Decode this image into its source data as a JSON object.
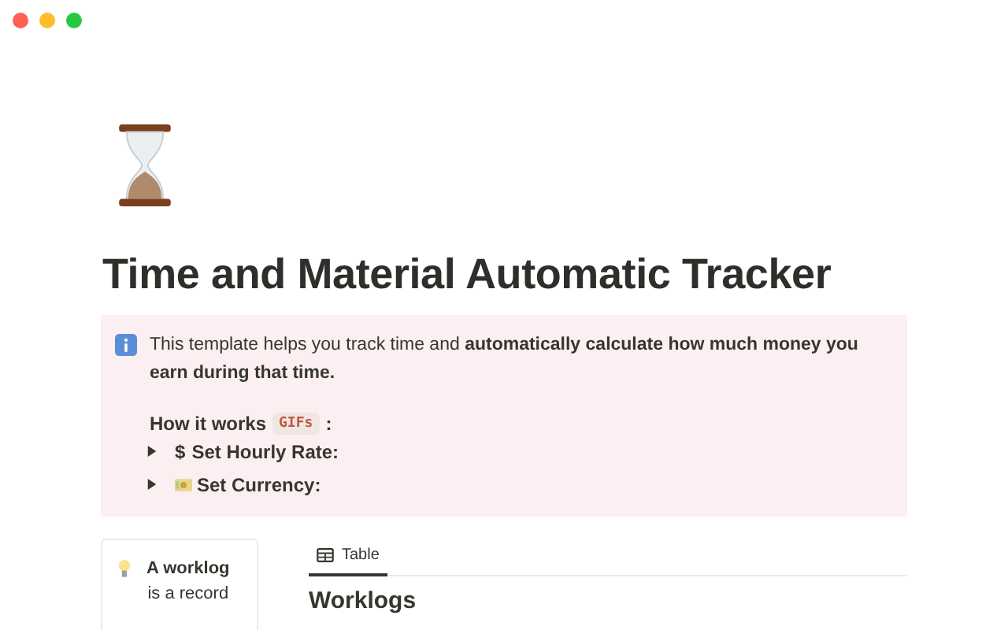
{
  "window": {
    "controls": [
      {
        "color": "#ff5f57"
      },
      {
        "color": "#febc2e"
      },
      {
        "color": "#28c840"
      }
    ]
  },
  "page": {
    "title": "Time and Material Automatic Tracker"
  },
  "callout": {
    "text": "This template helps you track time and **automatically calculate how much money you earn during that time.**",
    "how_label": "How it works",
    "code": "GIFs",
    "colon": ":",
    "toggles": [
      {
        "kind": "text_icon",
        "icon": "$",
        "label": "Set Hourly Rate:",
        "expanded": false
      },
      {
        "kind": "banknote",
        "label": "Set Currency:",
        "expanded": false
      }
    ]
  },
  "tip_card": {
    "title": "A worklog",
    "text": "is a record"
  },
  "view_tabs": [
    {
      "label": "Table",
      "selected": true
    }
  ],
  "database": {
    "title": "Worklogs"
  }
}
